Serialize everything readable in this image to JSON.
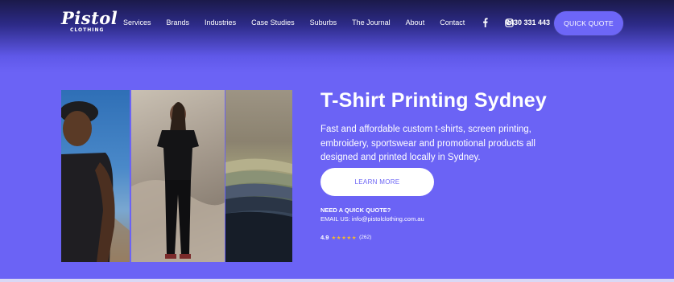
{
  "header": {
    "logo": {
      "word": "Pistol",
      "sub": "CLOTHING"
    },
    "nav": [
      {
        "label": "Services"
      },
      {
        "label": "Brands"
      },
      {
        "label": "Industries"
      },
      {
        "label": "Case Studies"
      },
      {
        "label": "Suburbs"
      },
      {
        "label": "The Journal"
      },
      {
        "label": "About"
      },
      {
        "label": "Contact"
      }
    ],
    "social": [
      {
        "icon": "facebook-icon"
      },
      {
        "icon": "instagram-icon"
      }
    ],
    "phone": "0430 331 443",
    "cta_label": "QUICK QUOTE"
  },
  "hero": {
    "title": "T-Shirt Printing Sydney",
    "description": "Fast and affordable custom t-shirts, screen printing, embroidery, sportswear and promotional products all designed and printed locally in Sydney.",
    "learn_more_label": "LEARN MORE",
    "need_quote": "NEED A QUICK QUOTE?",
    "email_line": "EMAIL US: info@pistolclothing.com.au",
    "rating": {
      "value": "4.9",
      "stars": "★★★★★",
      "count": "(262)"
    }
  },
  "colors": {
    "background": "#6b63f5",
    "header_dark": "#1b1a4a",
    "accent_button": "#6d66f7",
    "star": "#f5b82e"
  }
}
